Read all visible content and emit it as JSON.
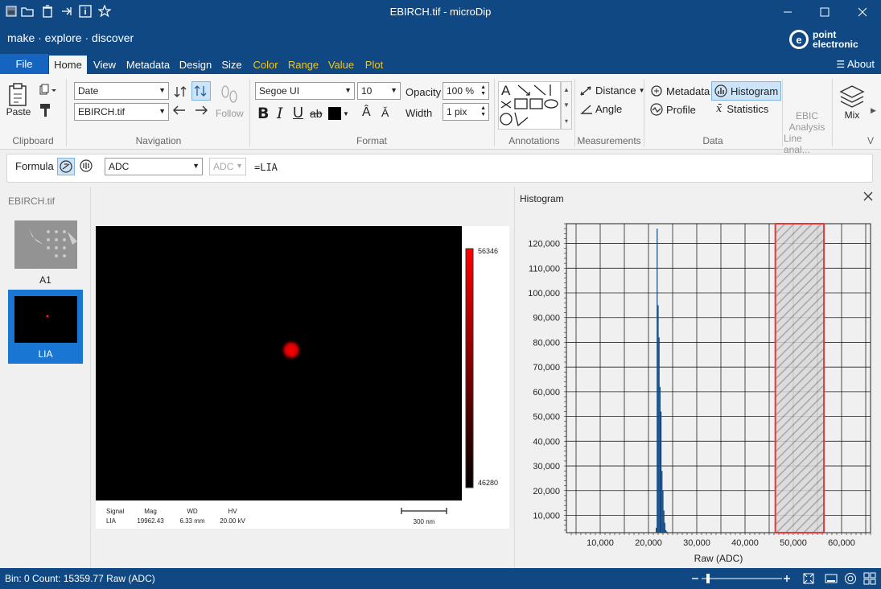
{
  "window": {
    "title": "EBIRCH.tif - microDip"
  },
  "brand": {
    "tagline": "make · explore · discover",
    "logo_line1": "point",
    "logo_line2": "electronic"
  },
  "menu": {
    "file": "File",
    "tabs": [
      "Home",
      "View",
      "Metadata",
      "Design",
      "Size",
      "Color",
      "Range",
      "Value",
      "Plot"
    ],
    "about": "About"
  },
  "ribbon": {
    "clipboard": {
      "paste": "Paste",
      "label": "Clipboard"
    },
    "navigation": {
      "sort_value": "Date",
      "file_value": "EBIRCH.tif",
      "follow": "Follow",
      "label": "Navigation"
    },
    "format": {
      "font": "Segoe UI",
      "size": "10",
      "opacity_label": "Opacity",
      "opacity_value": "100 %",
      "width_label": "Width",
      "width_value": "1 pix",
      "label": "Format"
    },
    "annotations": {
      "label": "Annotations"
    },
    "measurements": {
      "distance": "Distance",
      "angle": "Angle",
      "label": "Measurements"
    },
    "data": {
      "metadata": "Metadata",
      "histogram": "Histogram",
      "profile": "Profile",
      "statistics": "Statistics",
      "label": "Data"
    },
    "ebic": {
      "line1": "EBIC",
      "line2": "Analysis",
      "line3": "Line anal...",
      "label": ""
    },
    "mix": {
      "label": "Mix"
    },
    "cut": "V"
  },
  "formula": {
    "label": "Formula",
    "channel": "ADC",
    "unit": "ADC",
    "expression": "=LIA"
  },
  "files": {
    "heading": "EBIRCH.tif",
    "items": [
      {
        "label": "A1",
        "selected": false
      },
      {
        "label": "LIA",
        "selected": true
      }
    ]
  },
  "image": {
    "colorbar_max": "56346",
    "colorbar_min": "46280",
    "info": {
      "signal_label": "Signal",
      "signal_value": "LIA",
      "mag_label": "Mag",
      "mag_value": "19962.43",
      "wd_label": "WD",
      "wd_value": "6.33 mm",
      "hv_label": "HV",
      "hv_value": "20.00 kV",
      "scale": "300 nm"
    }
  },
  "histogram_panel": {
    "title": "Histogram",
    "xlabel": "Raw (ADC)"
  },
  "chart_data": {
    "type": "bar",
    "title": "",
    "xlabel": "Raw (ADC)",
    "ylabel": "",
    "xlim": [
      3000,
      66000
    ],
    "ylim": [
      3000,
      128000
    ],
    "x_ticks": [
      "10,000",
      "20,000",
      "30,000",
      "40,000",
      "50,000",
      "60,000"
    ],
    "y_ticks": [
      "10,000",
      "20,000",
      "30,000",
      "40,000",
      "50,000",
      "60,000",
      "70,000",
      "80,000",
      "90,000",
      "100,000",
      "110,000",
      "120,000"
    ],
    "bins_x": [
      21600,
      21800,
      22000,
      22200,
      22400,
      22600,
      22800,
      23000,
      23200,
      23400,
      23600,
      23800
    ],
    "bins_y": [
      5000,
      126000,
      95000,
      82000,
      62000,
      52000,
      28000,
      20000,
      12000,
      7000,
      4000,
      3500
    ],
    "highlight_range": [
      46280,
      56346
    ],
    "grid": true,
    "colors": {
      "bars": "#0f4883",
      "highlight": "#e53935"
    }
  },
  "status": {
    "text": "Bin: 0  Count: 15359.77 Raw (ADC)"
  }
}
